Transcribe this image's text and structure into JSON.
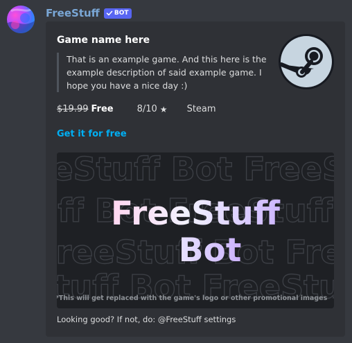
{
  "message": {
    "username": "FreeStuff",
    "badge": "BOT",
    "colors": {
      "username": "#7aa7d6",
      "badge": "#5865f2",
      "link": "#00aff4",
      "embed_bg": "#2f3136",
      "page_bg": "#36393f"
    }
  },
  "embed": {
    "title": "Game name here",
    "description": "That is an example game. And this here is the example description of said example game. I hope you have a nice day :)",
    "old_price": "$19.99",
    "price": "Free",
    "rating": "8/10",
    "rating_icon": "star-icon",
    "store": "Steam",
    "link_label": "Get it for free",
    "thumbnail_icon": "steam-logo-icon",
    "image": {
      "line1": "FreeStuff",
      "line2": "Bot",
      "pattern_text": "FreeStuff Bot FreeStuff Bot",
      "caption": "*This will get replaced with the game's logo or other promotional images"
    },
    "footer": "Looking good? If not, do: @FreeStuff settings"
  }
}
